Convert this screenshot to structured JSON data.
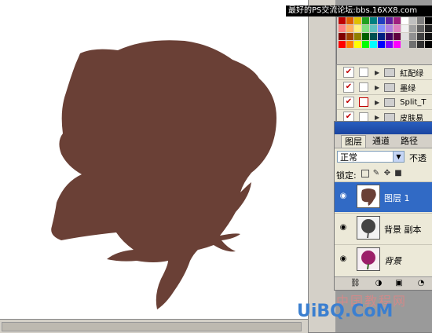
{
  "banner": {
    "text": "最好的PS交流论坛:bbs.16XX8.com"
  },
  "colors": {
    "silhouette": "#6a4036",
    "selection": "#316ac5"
  },
  "actions_panel": {
    "rows": [
      {
        "checked": "✔",
        "has_dialog": false,
        "label": "紅配绿"
      },
      {
        "checked": "✔",
        "has_dialog": false,
        "label": "墨绿"
      },
      {
        "checked": "✔",
        "has_dialog": true,
        "label": "Split_T"
      },
      {
        "checked": "✔",
        "has_dialog": false,
        "label": "皮肤易"
      }
    ]
  },
  "layers_panel": {
    "tabs": [
      {
        "label": "图层"
      },
      {
        "label": "通道"
      },
      {
        "label": "路径"
      }
    ],
    "blend_mode": "正常",
    "opacity_label": "不透",
    "lock_label": "锁定:",
    "layers": [
      {
        "name": "图层 1",
        "selected": true,
        "thumb_icon": "rose-silhouette-thumbnail"
      },
      {
        "name": "背景 副本",
        "selected": false,
        "thumb_icon": "gray-rose-thumbnail"
      },
      {
        "name": "背景",
        "selected": false,
        "thumb_icon": "color-rose-thumbnail"
      }
    ]
  },
  "watermark": {
    "line1": "中国教程网",
    "line2": "UiBQ.CoM"
  }
}
